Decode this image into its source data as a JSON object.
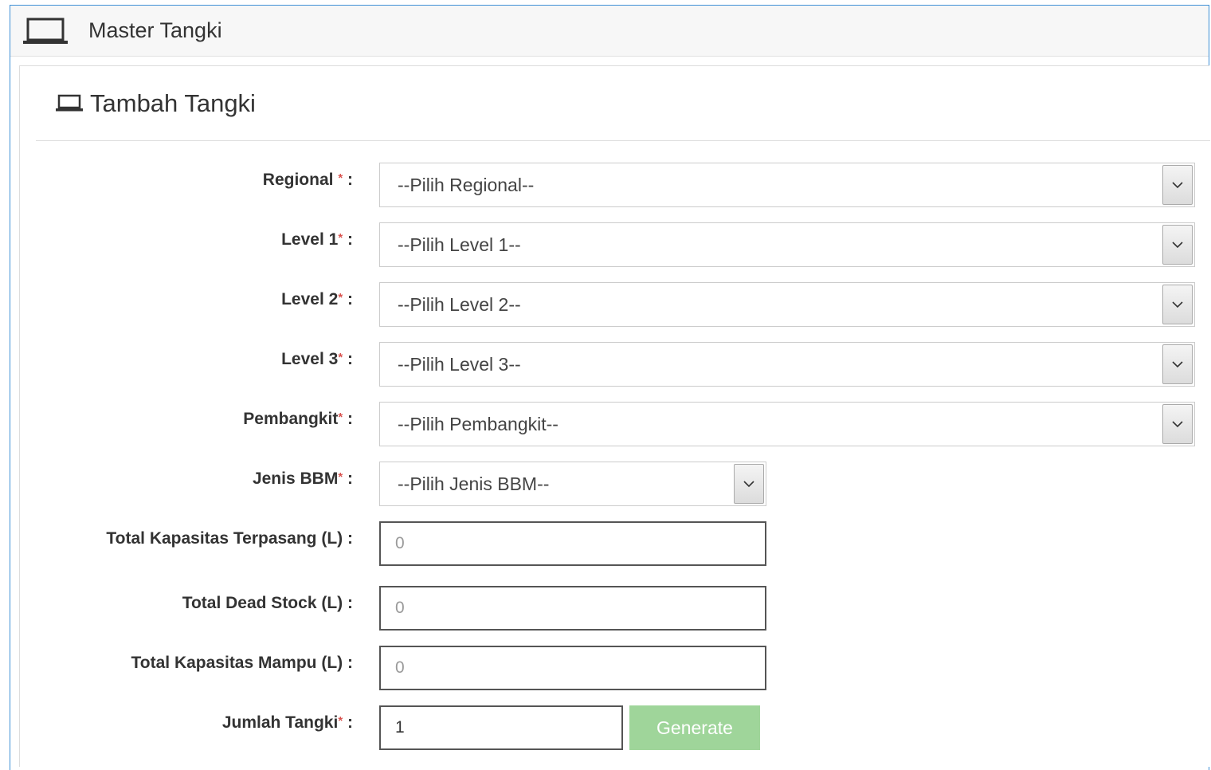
{
  "header": {
    "title": "Master Tangki",
    "icon": "laptop-icon"
  },
  "panel": {
    "title": "Tambah Tangki",
    "icon": "laptop-icon"
  },
  "form": {
    "regional": {
      "label": "Regional",
      "required_mark": "*",
      "colon": ":",
      "value": "--Pilih Regional--"
    },
    "level1": {
      "label": "Level 1",
      "required_mark": "*",
      "colon": ":",
      "value": "--Pilih Level 1--"
    },
    "level2": {
      "label": "Level 2",
      "required_mark": "*",
      "colon": ":",
      "value": "--Pilih Level 2--"
    },
    "level3": {
      "label": "Level 3",
      "required_mark": "*",
      "colon": ":",
      "value": "--Pilih Level 3--"
    },
    "pembangkit": {
      "label": "Pembangkit",
      "required_mark": "*",
      "colon": ":",
      "value": "--Pilih Pembangkit--"
    },
    "jenis_bbm": {
      "label": "Jenis BBM",
      "required_mark": "*",
      "colon": ":",
      "value": "--Pilih Jenis BBM--"
    },
    "total_kapasitas_terpasang": {
      "label": "Total Kapasitas Terpasang (L)",
      "colon": ":",
      "placeholder": "0"
    },
    "total_dead_stock": {
      "label": "Total Dead Stock (L)",
      "colon": ":",
      "placeholder": "0"
    },
    "total_kapasitas_mampu": {
      "label": "Total Kapasitas Mampu (L)",
      "colon": ":",
      "placeholder": "0"
    },
    "jumlah_tangki": {
      "label": "Jumlah Tangki",
      "required_mark": "*",
      "colon": ":",
      "value": "1",
      "button": "Generate"
    }
  },
  "colors": {
    "frame_border": "#3d8fd6",
    "required": "#d9534f",
    "generate_button": "#9fd59a"
  }
}
